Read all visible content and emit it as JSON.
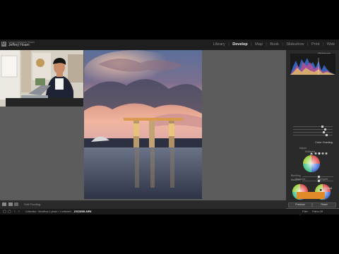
{
  "identity": {
    "line1": "Lance Lightroom Vision",
    "name": "Jeffrey Hoam"
  },
  "modules": [
    {
      "label": "Library"
    },
    {
      "label": "Develop",
      "active": true
    },
    {
      "label": "Map"
    },
    {
      "label": "Book"
    },
    {
      "label": "Slideshow"
    },
    {
      "label": "Print"
    },
    {
      "label": "Web"
    }
  ],
  "panel": {
    "histogram_title": "Histogram",
    "color_grading_title": "Color Grading",
    "adjust_label": "Adjust",
    "midtones_label": "Midtones",
    "shadows_label": "Shadows",
    "highlights_label": "Highlights",
    "blending_label": "Blending",
    "balance_label": "Balance",
    "detail_title": "Detail",
    "previous_button": "Previous",
    "reset_button": "Reset"
  },
  "filmstrip": {
    "soft_proofing": "Soft Proofing"
  },
  "bottom_bar": {
    "collection_prefix": "Collection : Workflow",
    "crumb_mid": "1 photo / 1 selected /",
    "filename": "_DSC8088.ARW",
    "filter_label": "Filter :",
    "filter_value": "Filters Off"
  },
  "colors": {
    "accent_orange": "#e08a2a",
    "panel_bg": "#2a2a2a",
    "canvas_bg": "#5c5c5c"
  }
}
